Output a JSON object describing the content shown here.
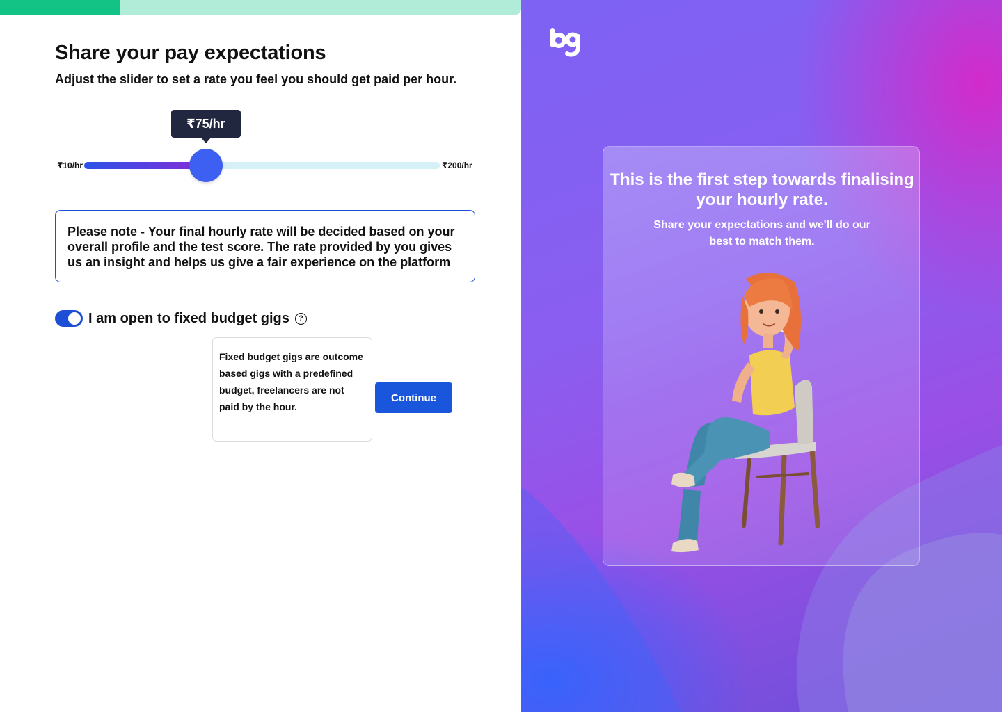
{
  "progress": {
    "value": 0.23
  },
  "header": {
    "title": "Share your pay expectations",
    "subtitle": "Adjust the slider to set a rate you feel you should get paid per hour."
  },
  "slider": {
    "current_label": "₹75/hr",
    "min_label": "₹10/hr",
    "max_label": "₹200/hr",
    "min": 10,
    "max": 200,
    "value": 75
  },
  "note": {
    "text": "Please note - Your final hourly rate will be decided based on your overall profile and the test score. The rate provided by you gives us an insight and helps us give a fair experience on the platform"
  },
  "fixed_budget": {
    "label": "I am open to fixed budget gigs",
    "toggle_on": true,
    "help_icon": "question-circle-icon",
    "help_symbol": "?",
    "tooltip": "Fixed budget gigs are outcome based gigs with a predefined budget, freelancers are not paid by the hour."
  },
  "actions": {
    "continue_label": "Continue"
  },
  "promo": {
    "logo_text": "bg",
    "title": "This is the first step towards finalising your hourly rate.",
    "subtitle": "Share your expectations and we'll do our best to match them.",
    "illustration": "woman-on-phone-sitting-chair"
  },
  "colors": {
    "progress_fill": "#13c386",
    "progress_track": "#b1ecd9",
    "primary": "#1a56db",
    "tooltip_bg": "#222740"
  }
}
